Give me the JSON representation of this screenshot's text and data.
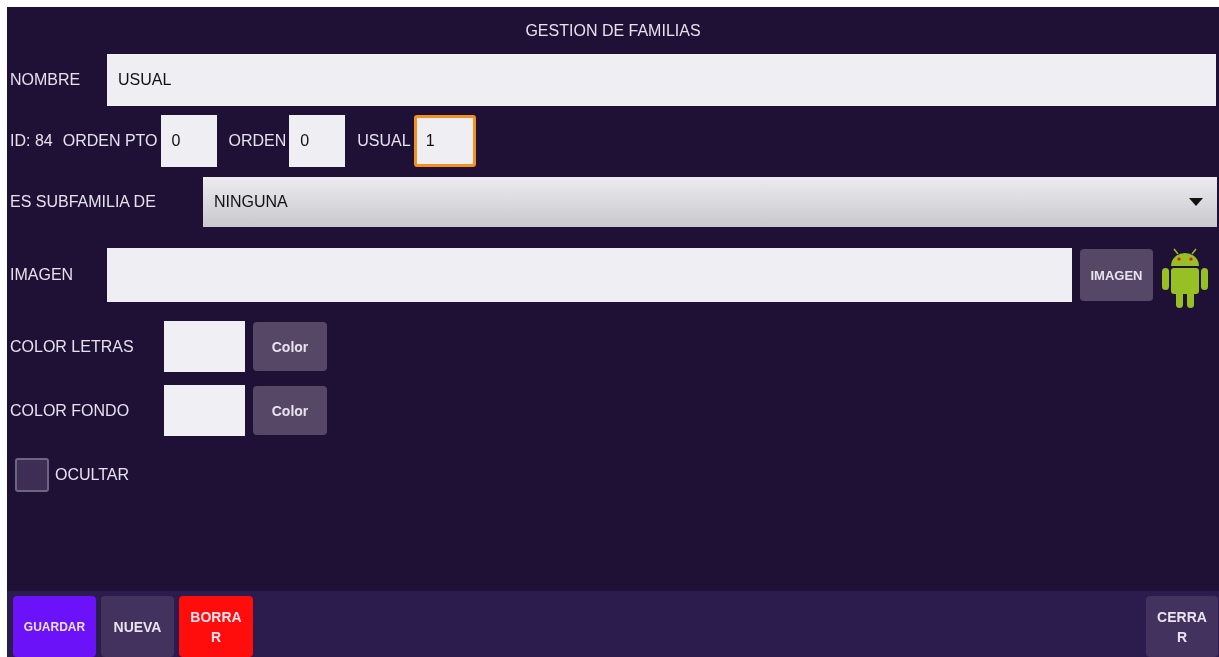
{
  "title": "GESTION DE FAMILIAS",
  "nombre": {
    "label": "NOMBRE",
    "value": "USUAL"
  },
  "id_label": "ID: 84",
  "small_fields": [
    {
      "label": "ORDEN PTO",
      "value": "0",
      "focused": false
    },
    {
      "label": "ORDEN",
      "value": "0",
      "focused": false
    },
    {
      "label": "USUAL",
      "value": "1",
      "focused": true
    }
  ],
  "subfamilia": {
    "label": "ES SUBFAMILIA DE",
    "value": "NINGUNA"
  },
  "imagen": {
    "label": "IMAGEN",
    "button": "IMAGEN"
  },
  "colors": [
    {
      "label": "COLOR LETRAS",
      "button": "Color"
    },
    {
      "label": "COLOR FONDO",
      "button": "Color"
    }
  ],
  "ocultar": {
    "label": "OCULTAR",
    "checked": false
  },
  "buttons": [
    {
      "label": "GUARDAR",
      "kind": "primary"
    },
    {
      "label": "NUEVA",
      "kind": "normal"
    },
    {
      "label": "BORRAR",
      "kind": "danger"
    },
    {
      "label": "CERRAR",
      "kind": "right"
    }
  ]
}
